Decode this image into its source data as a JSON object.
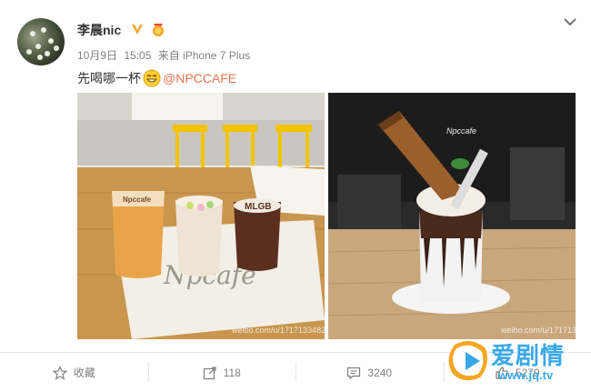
{
  "user": {
    "name": "李晨nic",
    "avatar": "avatar-image"
  },
  "meta": {
    "date": "10月9日",
    "time": "15:05",
    "source": "来自 iPhone 7 Plus"
  },
  "post": {
    "text": "先喝哪一杯",
    "emoji": "grin-emoji",
    "mention": "@NPCCAFE"
  },
  "photos": [
    {
      "desc_icon": "image-icon",
      "watermark": "weibo.com/u/1717133482"
    },
    {
      "desc_icon": "image-icon",
      "watermark": "weibo.com/u/1717133482"
    }
  ],
  "actions": [
    {
      "icon": "star-icon",
      "label": "收藏"
    },
    {
      "icon": "share-icon",
      "label": "118"
    },
    {
      "icon": "comment-icon",
      "label": "3240"
    },
    {
      "icon": "like-icon",
      "label": "5279"
    }
  ],
  "logo": {
    "cn": "爱剧情",
    "url": "www.jq.tv"
  },
  "colors": {
    "mention": "#eb7350",
    "badge": "#f5a623",
    "logo": "#3aa8e6"
  }
}
